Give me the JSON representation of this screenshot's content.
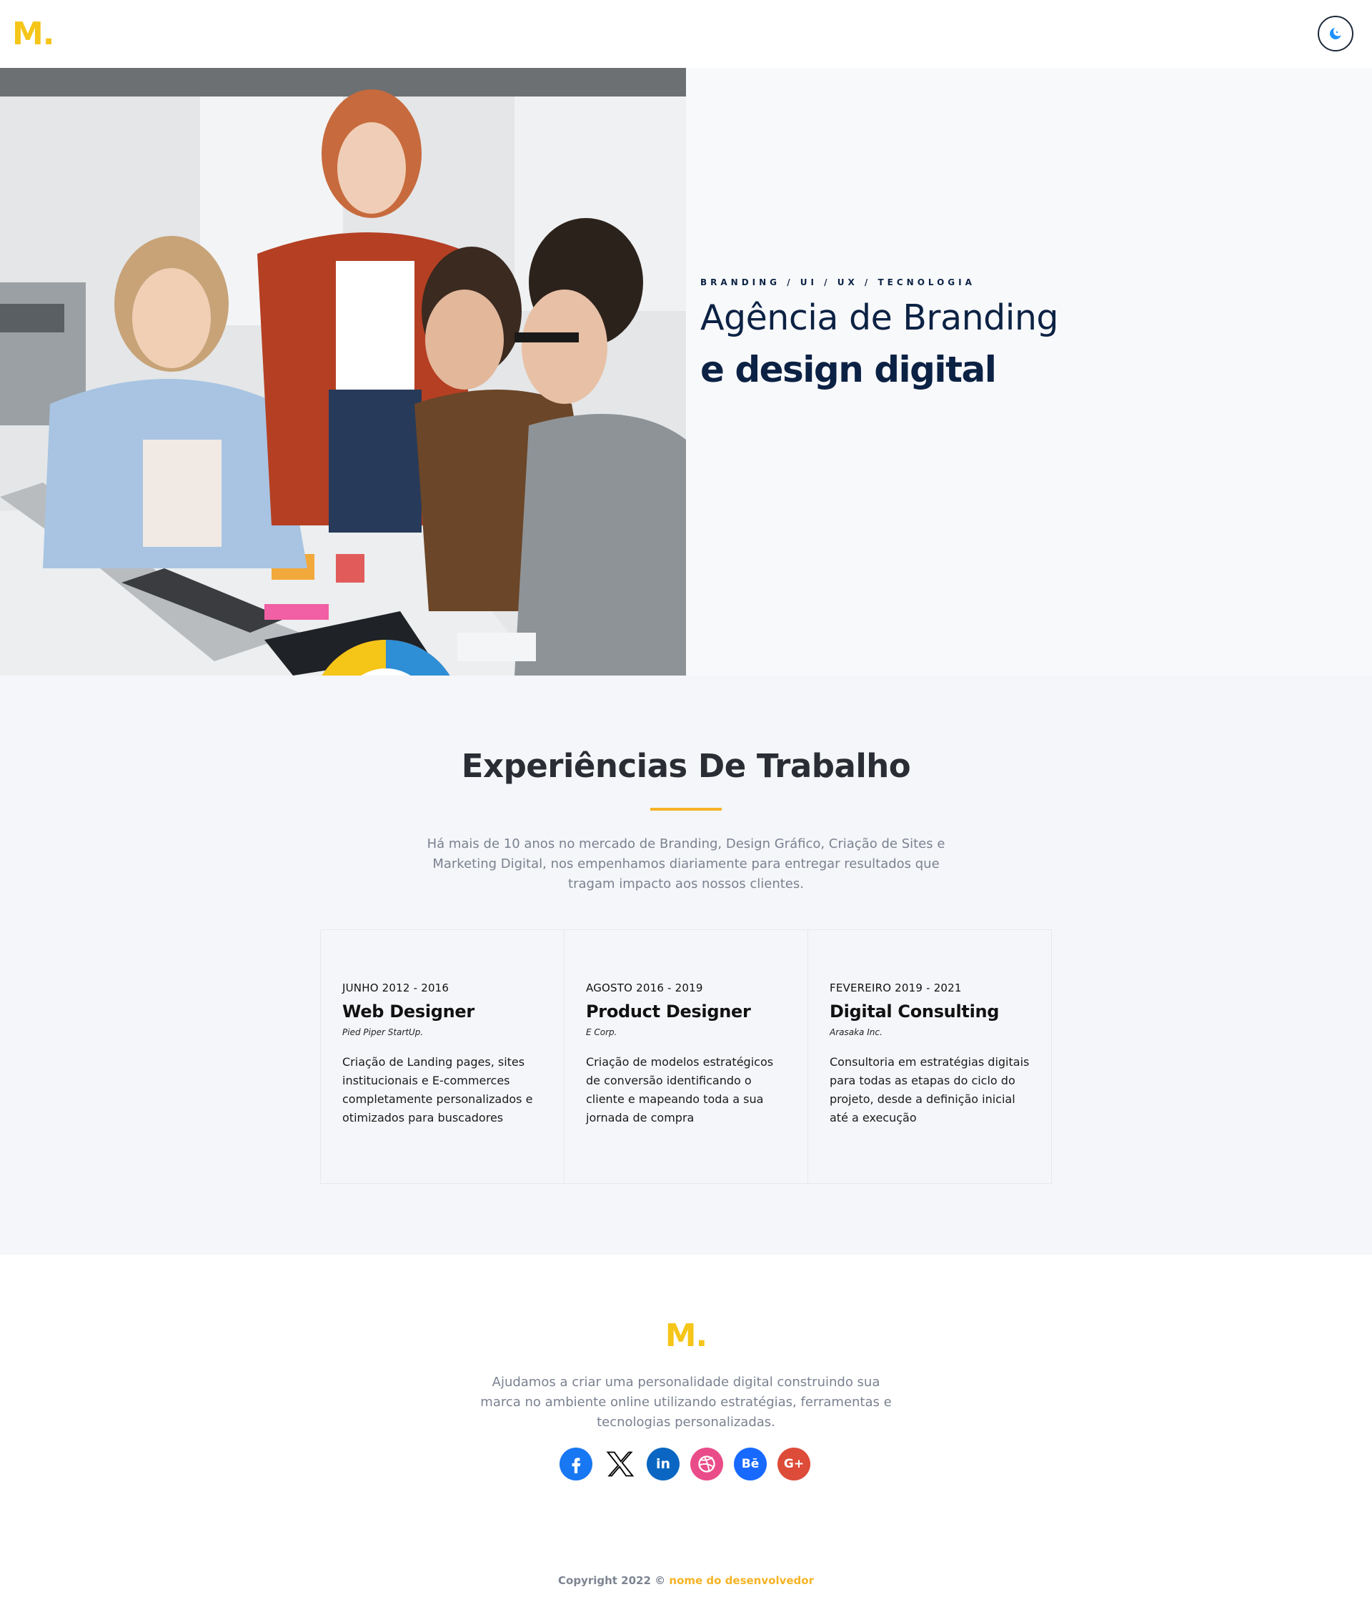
{
  "header": {
    "logo": "M.",
    "theme_toggle_icon": "moon-icon"
  },
  "hero": {
    "tags": "BRANDING / UI / UX / TECNOLOGIA",
    "title": "Agência de Branding",
    "subtitle": "e design digital",
    "photo": "team-meeting-photo"
  },
  "experience": {
    "title": "Experiências De Trabalho",
    "description": "Há mais de 10 anos no mercado de Branding, Design Gráfico, Criação de Sites e Marketing Digital, nos empenhamos diariamente para entregar resultados que tragam impacto aos nossos clientes.",
    "accent_color": "#f5b324",
    "items": [
      {
        "date": "JUNHO 2012 - 2016",
        "role": "Web Designer",
        "company": "Pied Piper StartUp.",
        "text": "Criação de Landing pages, sites institucionais e E-commerces completamente personalizados e otimizados para buscadores"
      },
      {
        "date": "AGOSTO 2016 - 2019",
        "role": "Product Designer",
        "company": "E Corp.",
        "text": "Criação de modelos estratégicos de conversão identificando o cliente e mapeando toda a sua jornada de compra"
      },
      {
        "date": "FEVEREIRO 2019 - 2021",
        "role": "Digital Consulting",
        "company": "Arasaka Inc.",
        "text": "Consultoria em estratégias digitais para todas as etapas do ciclo do projeto, desde a definição inicial até a execução"
      }
    ]
  },
  "footer": {
    "logo": "M.",
    "description": "Ajudamos a criar uma personalidade digital construindo sua marca no ambiente online utilizando estratégias, ferramentas e tecnologias personalizadas.",
    "socials": [
      {
        "icon": "facebook-icon",
        "color": "#1877f2"
      },
      {
        "icon": "x-icon",
        "color": "#000000"
      },
      {
        "icon": "linkedin-icon",
        "color": "#0a66c2",
        "label": "in"
      },
      {
        "icon": "dribbble-icon",
        "color": "#ea4c89"
      },
      {
        "icon": "behance-icon",
        "color": "#1769ff",
        "label": "Bē"
      },
      {
        "icon": "google-plus-icon",
        "color": "#dd4b39",
        "label": "G+"
      }
    ],
    "copyright_prefix": "Copyright 2022 ©",
    "copyright_name": "nome do desenvolvedor"
  },
  "colors": {
    "brand_yellow": "#f5c518",
    "navy": "#0c2244"
  }
}
